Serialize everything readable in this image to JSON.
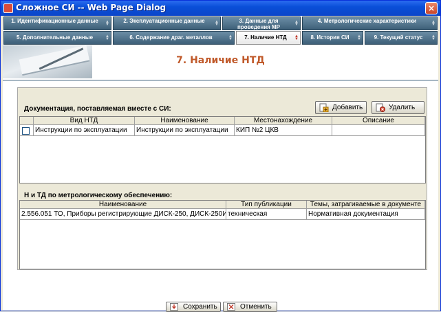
{
  "window": {
    "title": "Сложное СИ -- Web Page Dialog",
    "close_label": "×"
  },
  "tabs_row1": [
    {
      "label": "1. Идентификационные данные",
      "active": false
    },
    {
      "label": "2. Эксплуатационные данные",
      "active": false
    },
    {
      "label": "3. Данные для проведения МР",
      "active": false
    },
    {
      "label": "4. Метрологические характеристики",
      "active": false
    }
  ],
  "tabs_row2": [
    {
      "label": "5. Дополнительные данные",
      "active": false
    },
    {
      "label": "6. Содержание драг. металлов",
      "active": false
    },
    {
      "label": "7. Наличие НТД",
      "active": true
    },
    {
      "label": "8. История СИ",
      "active": false
    },
    {
      "label": "9. Текущий статус",
      "active": false
    }
  ],
  "banner": {
    "title": "7. Наличие НТД",
    "title_color": "#c0592a"
  },
  "documentation": {
    "section_label": "Документация, поставляемая вместе с СИ:",
    "add_label": "Добавить",
    "delete_label": "Удалить",
    "columns": [
      "Вид НТД",
      "Наименование",
      "Местонахождение",
      "Описание"
    ],
    "rows": [
      {
        "checked": false,
        "cells": [
          "Инструкции по эксплуатации",
          "Инструкции по эксплуатации",
          "КИП №2 ЦКВ",
          ""
        ]
      }
    ]
  },
  "metrology": {
    "section_label": "Н и ТД по метрологическому обеспечению:",
    "columns": [
      "Наименование",
      "Тип публикации",
      "Темы, затрагиваемые в документе"
    ],
    "rows": [
      {
        "cells": [
          "2.556.051 ТО, Приборы регистрирующие ДИСК-250, ДИСК-250И",
          "техническая",
          "Нормативная документация"
        ]
      }
    ]
  },
  "footer": {
    "save_label": "Сохранить",
    "cancel_label": "Отменить"
  },
  "colors": {
    "tab_bg": "#4f7189",
    "titlebar": "#0a4fd8",
    "accent": "#c0592a"
  },
  "icons": {
    "add": "add-document-icon",
    "delete": "delete-document-icon",
    "save": "save-icon",
    "cancel": "cancel-icon",
    "app": "app-icon",
    "scroll": "tab-scroll-icon"
  }
}
